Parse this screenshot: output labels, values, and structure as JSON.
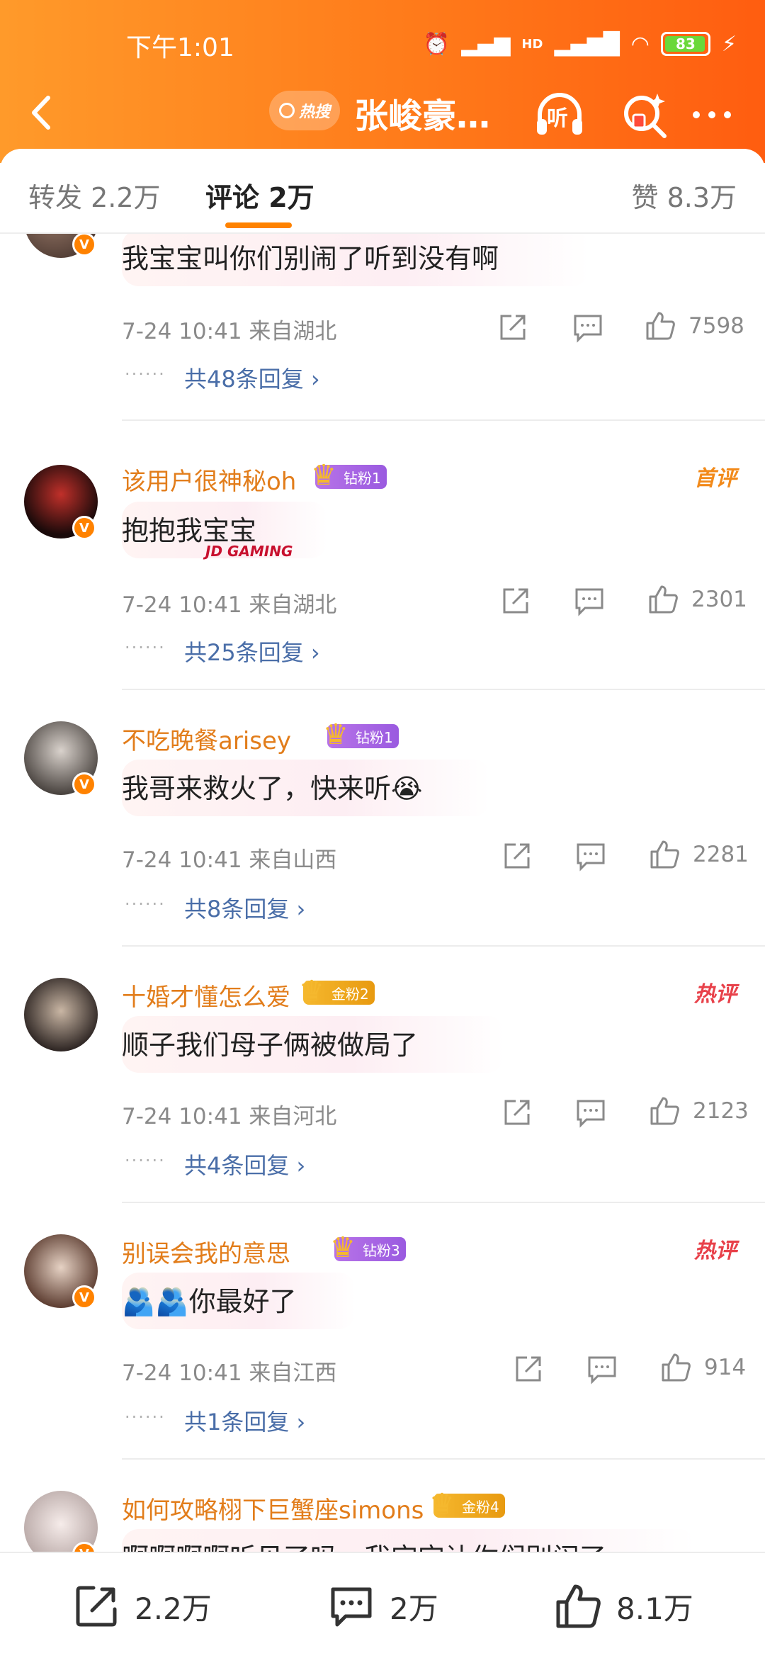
{
  "status": {
    "time": "下午1:01",
    "hd": "HD",
    "battery": "83"
  },
  "nav": {
    "hot_badge": "热搜",
    "title": "张峻豪…",
    "listen": "听"
  },
  "tabs": [
    {
      "label": "转发 2.2万"
    },
    {
      "label": "评论 2万"
    },
    {
      "label": "赞 8.3万"
    }
  ],
  "comments": [
    {
      "username": "",
      "fan": "",
      "tag": "",
      "text": "我宝宝叫你们别闹了听到没有啊",
      "time": "7-24 10:41 来自湖北",
      "likes": "7598",
      "replies": "共48条回复"
    },
    {
      "username": "该用户很神秘oh",
      "fan": "钻粉1",
      "tag": "首评",
      "text": "抱抱我宝宝",
      "sticker": "JD GAMING",
      "time": "7-24 10:41 来自湖北",
      "likes": "2301",
      "replies": "共25条回复"
    },
    {
      "username": "不吃晚餐arisey",
      "fan": "钻粉1",
      "tag": "",
      "text": "我哥来救火了，快来听😭",
      "time": "7-24 10:41 来自山西",
      "likes": "2281",
      "replies": "共8条回复"
    },
    {
      "username": "十婚才懂怎么爱",
      "fan": "金粉2",
      "tag": "热评",
      "text": "顺子我们母子俩被做局了",
      "time": "7-24 10:41 来自河北",
      "likes": "2123",
      "replies": "共4条回复"
    },
    {
      "username": "别误会我的意思",
      "fan": "钻粉3",
      "tag": "热评",
      "text": "🫂🫂你最好了",
      "time": "7-24 10:41 来自江西",
      "likes": "914",
      "replies": "共1条回复"
    },
    {
      "username": "如何攻略栩下巨蟹座simons",
      "fan": "金粉4",
      "tag": "",
      "text": "啊啊啊啊听见了吗。我宝宝让你们别闹了",
      "time": "",
      "likes": "",
      "replies": ""
    }
  ],
  "bottom": {
    "repost": "2.2万",
    "comment": "2万",
    "like": "8.1万"
  },
  "colors": {
    "header_start": "#ff9a2a",
    "header_end": "#ff5d10",
    "accent": "#ff8200",
    "username": "#e27d1b",
    "link": "#4a6ea8"
  }
}
